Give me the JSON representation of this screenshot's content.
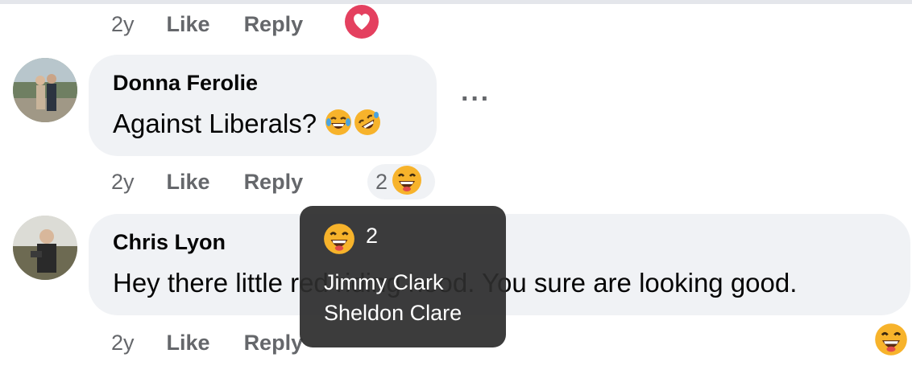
{
  "top_comment_meta": {
    "time": "2y",
    "like": "Like",
    "reply": "Reply"
  },
  "comments": [
    {
      "author": "Donna Ferolie",
      "text": "Against Liberals?",
      "time": "2y",
      "like": "Like",
      "reply": "Reply",
      "reaction_count": "2",
      "text_emojis": [
        "face-with-tears-of-joy",
        "rolling-on-the-floor-laughing"
      ],
      "more_icon": "more-horizontal-icon"
    },
    {
      "author": "Chris Lyon",
      "text": "Hey there little red riding hood. You sure are looking good.",
      "time": "2y",
      "like": "Like",
      "reply": "Reply"
    }
  ],
  "tooltip": {
    "count": "2",
    "names": [
      "Jimmy Clark",
      "Sheldon Clare"
    ]
  },
  "colors": {
    "bubble": "#f0f2f5",
    "meta_text": "#65676b",
    "heart": "#e4405f",
    "tooltip_bg": "#2d2d2d"
  }
}
